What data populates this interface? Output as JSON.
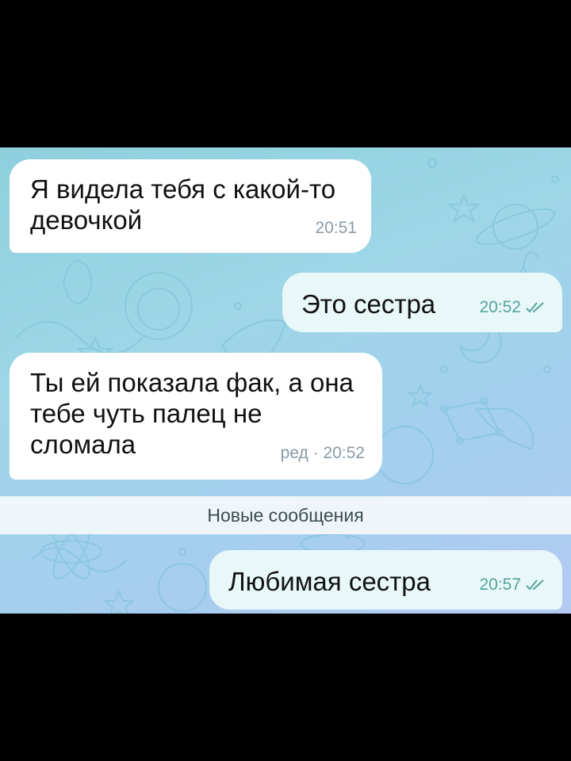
{
  "messages": [
    {
      "text": "Я видела тебя с какой-то\nдевочкой",
      "time": "20:51",
      "direction": "incoming"
    },
    {
      "text": "Это сестра",
      "time": "20:52",
      "direction": "outgoing",
      "status": "read"
    },
    {
      "text": "Ты ей показала фак, а она\nтебе чуть палец не\nсломала",
      "edited_label": "ред",
      "time": "20:52",
      "direction": "incoming"
    },
    {
      "text": "Любимая сестра",
      "time": "20:57",
      "direction": "outgoing",
      "status": "read"
    }
  ],
  "divider": {
    "label": "Новые сообщения"
  },
  "colors": {
    "background_gradient": [
      "#8fd0dd",
      "#b4c9f2"
    ],
    "incoming_bubble": "#ffffff",
    "outgoing_bubble": "#e8f7f7",
    "outgoing_meta": "#55a39d",
    "letterbox": "#000000"
  },
  "icons": {
    "read_receipt": "double-check-icon"
  }
}
